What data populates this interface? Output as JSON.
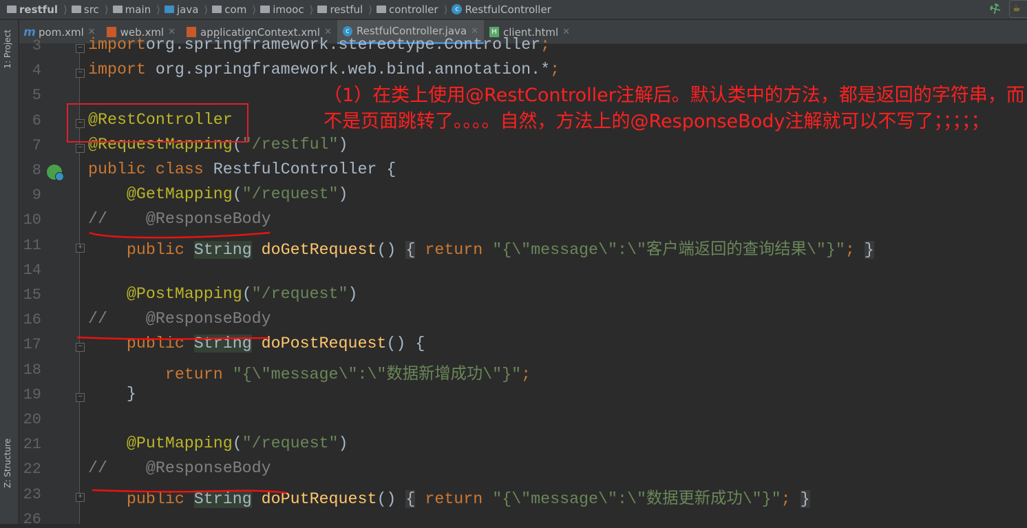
{
  "breadcrumb": [
    "restful",
    "src",
    "main",
    "java",
    "com",
    "imooc",
    "restful",
    "controller",
    "RestfulController"
  ],
  "side_tabs": {
    "project": "1: Project",
    "structure": "Z: Structure"
  },
  "tabs": [
    {
      "label": "pom.xml",
      "icon": "m"
    },
    {
      "label": "web.xml",
      "icon": "xml"
    },
    {
      "label": "applicationContext.xml",
      "icon": "xml"
    },
    {
      "label": "RestfulController.java",
      "icon": "c",
      "active": true
    },
    {
      "label": "client.html",
      "icon": "H"
    }
  ],
  "code": [
    {
      "n": "3",
      "t": [
        [
          "kw",
          "import"
        ],
        [
          "",
          "org.springframework.stereotype.Controller"
        ],
        [
          "kw",
          ";"
        ]
      ]
    },
    {
      "n": "4",
      "t": [
        [
          "kw",
          "import "
        ],
        [
          "",
          "org.springframework.web.bind.annotation.*"
        ],
        [
          "kw",
          ";"
        ]
      ]
    },
    {
      "n": "5",
      "t": []
    },
    {
      "n": "6",
      "t": [
        [
          "an",
          "@RestController"
        ]
      ]
    },
    {
      "n": "7",
      "t": [
        [
          "an",
          "@RequestMapping"
        ],
        [
          "",
          "("
        ],
        [
          "st",
          "\"/restful\""
        ],
        [
          "",
          ")"
        ]
      ]
    },
    {
      "n": "8",
      "t": [
        [
          "kw",
          "public class "
        ],
        [
          "",
          "RestfulController {"
        ]
      ]
    },
    {
      "n": "9",
      "t": [
        [
          "",
          "    "
        ],
        [
          "an",
          "@GetMapping"
        ],
        [
          "",
          "("
        ],
        [
          "st",
          "\"/request\""
        ],
        [
          "",
          ")"
        ]
      ]
    },
    {
      "n": "10",
      "t": [
        [
          "cm",
          "//    @ResponseBody"
        ]
      ]
    },
    {
      "n": "11",
      "t": [
        [
          "",
          "    "
        ],
        [
          "kw",
          "public "
        ],
        [
          "ty",
          "String"
        ],
        [
          "",
          " "
        ],
        [
          "fn",
          "doGetRequest"
        ],
        [
          "",
          "() "
        ],
        [
          "br",
          "{"
        ],
        [
          "",
          " "
        ],
        [
          "kw",
          "return "
        ],
        [
          "st",
          "\"{\\\"message\\\":\\\"客户端返回的查询结果\\\"}\""
        ],
        [
          "kw",
          ";"
        ],
        [
          "",
          " "
        ],
        [
          "br",
          "}"
        ]
      ]
    },
    {
      "n": "14",
      "t": []
    },
    {
      "n": "15",
      "t": [
        [
          "",
          "    "
        ],
        [
          "an",
          "@PostMapping"
        ],
        [
          "",
          "("
        ],
        [
          "st",
          "\"/request\""
        ],
        [
          "",
          ")"
        ]
      ]
    },
    {
      "n": "16",
      "t": [
        [
          "cm",
          "//    @ResponseBody"
        ]
      ]
    },
    {
      "n": "17",
      "t": [
        [
          "",
          "    "
        ],
        [
          "kw",
          "public "
        ],
        [
          "ty",
          "String"
        ],
        [
          "",
          " "
        ],
        [
          "fn",
          "doPostRequest"
        ],
        [
          "",
          "() {"
        ]
      ]
    },
    {
      "n": "18",
      "t": [
        [
          "",
          "        "
        ],
        [
          "kw",
          "return "
        ],
        [
          "st",
          "\"{\\\"message\\\":\\\"数据新增成功\\\"}\""
        ],
        [
          "kw",
          ";"
        ]
      ]
    },
    {
      "n": "19",
      "t": [
        [
          "",
          "    }"
        ]
      ]
    },
    {
      "n": "20",
      "t": []
    },
    {
      "n": "21",
      "t": [
        [
          "",
          "    "
        ],
        [
          "an",
          "@PutMapping"
        ],
        [
          "",
          "("
        ],
        [
          "st",
          "\"/request\""
        ],
        [
          "",
          ")"
        ]
      ]
    },
    {
      "n": "22",
      "t": [
        [
          "cm",
          "//    @ResponseBody"
        ]
      ]
    },
    {
      "n": "23",
      "t": [
        [
          "",
          "    "
        ],
        [
          "kw",
          "public "
        ],
        [
          "ty",
          "String"
        ],
        [
          "",
          " "
        ],
        [
          "fn",
          "doPutRequest"
        ],
        [
          "",
          "() "
        ],
        [
          "br",
          "{"
        ],
        [
          "",
          " "
        ],
        [
          "kw",
          "return "
        ],
        [
          "st",
          "\"{\\\"message\\\":\\\"数据更新成功\\\"}\""
        ],
        [
          "kw",
          ";"
        ],
        [
          "",
          " "
        ],
        [
          "br",
          "}"
        ]
      ]
    },
    {
      "n": "26",
      "t": []
    }
  ],
  "note": "（1）在类上使用@RestController注解后。默认类中的方法，都是返回的字符串，而不是页面跳转了。。。。自然，方法上的@ResponseBody注解就可以不写了；；；；；"
}
